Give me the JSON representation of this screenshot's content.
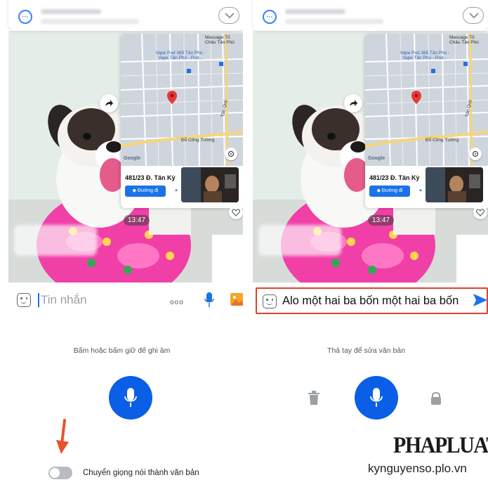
{
  "left_screen": {
    "message_time": "13:47",
    "map": {
      "labels": [
        "Massage Tố Châu Tân Phú",
        "Vape Pod 365 Tân Phú - Vape Tân Phú - Pod...",
        "Đỗ Công Tường",
        "Tân Quý",
        "Google"
      ],
      "address": "481/23 Đ. Tân Kỳ",
      "route_label": "Đường đi"
    },
    "input": {
      "placeholder": "Tin nhắn",
      "more_label": "ooo"
    },
    "hint": "Bấm hoặc bấm giữ để ghi âm",
    "toggle": {
      "label": "Chuyển giọng nói thành văn bản",
      "on": false
    }
  },
  "right_screen": {
    "message_time": "13:47",
    "map": {
      "labels": [
        "Massage Tố Châu Tân Phú",
        "Vape Pod 365 Tân Phú - Vape Tân Phú - Pod...",
        "Đỗ Công Tường",
        "Tân Quý",
        "Google"
      ],
      "address": "481/23 Đ. Tân Kỳ",
      "route_label": "Đường đi"
    },
    "input": {
      "value": "Alo một hai ba bốn một hai ba bốn"
    },
    "hint": "Thả tay để sửa văn bản"
  },
  "watermark": {
    "brand": "PHAPLUAT",
    "site": "kynguyenso.plo.vn"
  },
  "colors": {
    "accent": "#0a5fe6",
    "highlight_border": "#e3412b",
    "arrow": "#e8532c"
  }
}
